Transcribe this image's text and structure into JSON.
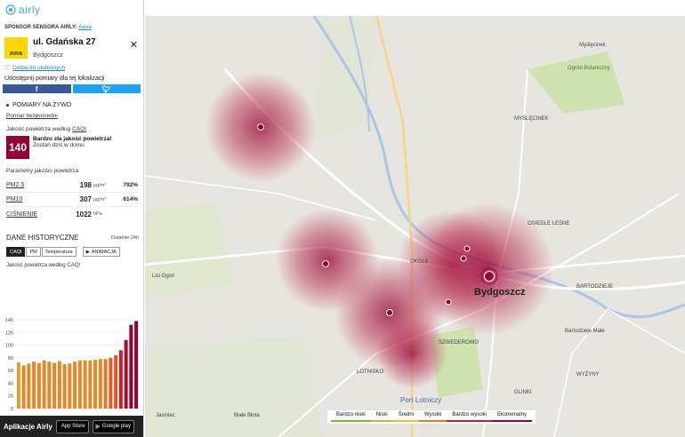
{
  "brand": {
    "logo": "airly"
  },
  "sponsor": {
    "label": "SPONSOR SENSORA AIRLY:",
    "name": "Aviva"
  },
  "sensor": {
    "street": "ul. Gdańska 27",
    "city": "Bydgoszcz",
    "logo_text": "AVIVA"
  },
  "actions": {
    "favorite": "Dodaj do ulubionych",
    "share": "Udostępnij pomiary dla tej lokalizacji"
  },
  "live": {
    "title": "POMIARY NA ŻYWO",
    "direct": "Pomiar bezpośredni",
    "quality_label": "Jakość powietrza według",
    "quality_index": "CAQI"
  },
  "alert": {
    "value": "140",
    "title": "Bardzo zła jakość powietrza!",
    "subtitle": "Zostań dziś w domu",
    "color": "#960032"
  },
  "params": {
    "title": "Parametry jakości powietrza",
    "rows": [
      {
        "name": "PM2.5",
        "value": "198",
        "unit": "μg/m³",
        "percent": "792%"
      },
      {
        "name": "PM10",
        "value": "307",
        "unit": "μg/m³",
        "percent": "614%"
      },
      {
        "name": "CIŚNIENIE",
        "value": "1022",
        "unit": "hPa",
        "percent": ""
      }
    ]
  },
  "history": {
    "title": "DANE HISTORYCZNE",
    "range": "Ostatnie 24h",
    "tabs": [
      "CAQI",
      "PM",
      "Temperatura"
    ],
    "animation": "ANIMACJA",
    "chart_title": "Jakość powietrza według CAQI"
  },
  "chart_data": {
    "type": "bar",
    "title": "Jakość powietrza według CAQI",
    "ylim": [
      0,
      140
    ],
    "yticks": [
      0,
      20,
      40,
      60,
      80,
      100,
      120,
      140
    ],
    "values": [
      73,
      68,
      71,
      74,
      72,
      76,
      74,
      72,
      75,
      70,
      71,
      74,
      76,
      76,
      76,
      77,
      78,
      78,
      80,
      84,
      92,
      108,
      132,
      138
    ],
    "colors": [
      "#e0a030",
      "#e08a2a",
      "#e08a2a",
      "#e08a2a",
      "#e08a2a",
      "#e08a2a",
      "#e08a2a",
      "#e08a2a",
      "#e08a2a",
      "#e08a2a",
      "#e08a2a",
      "#e08a2a",
      "#e08a2a",
      "#e08a2a",
      "#e08a2a",
      "#e08a2a",
      "#e08a2a",
      "#e07a28",
      "#e05a28",
      "#e05a28",
      "#c02030",
      "#a01030",
      "#960032",
      "#960032"
    ]
  },
  "apps": {
    "label": "Aplikacje Airly",
    "store1": "App Store",
    "store2": "Google play"
  },
  "map": {
    "city": "Bydgoszcz",
    "labels": [
      "OKOLE",
      "SZWEDEROWO",
      "LOTNISKO",
      "Port Lotniczy",
      "OSIEDLE LEŚNE",
      "MYŚLĘCINEK",
      "BARTODZIEJE",
      "WYŻYNY",
      "GLINKI",
      "Lisi Ogon",
      "Białe Błota",
      "Jasiniec",
      "Ogród Botaniczny",
      "Bartodzieje Małe",
      "Myślęcinek"
    ],
    "legend": [
      "Bardzo niski",
      "Niski",
      "Średni",
      "Wysoki",
      "Bardzo wysoki",
      "Ekstremalny"
    ],
    "legend_colors": [
      "#6cbf2a",
      "#a8c838",
      "#f0c030",
      "#e07a28",
      "#c02030",
      "#960032"
    ]
  }
}
